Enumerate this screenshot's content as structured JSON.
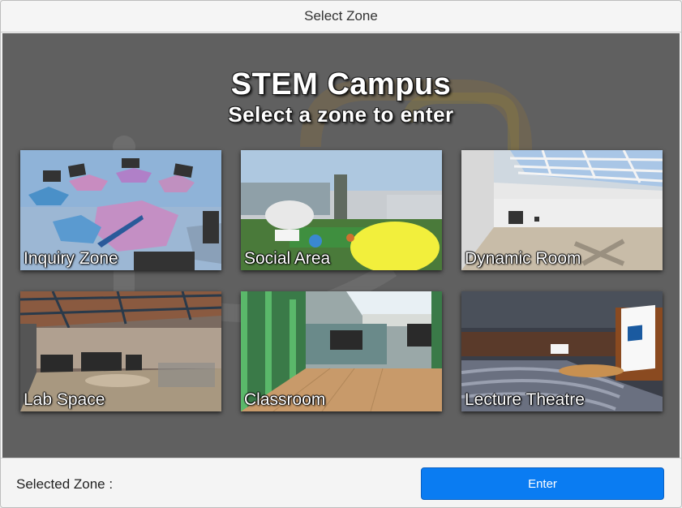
{
  "window": {
    "title": "Select Zone"
  },
  "header": {
    "title": "STEM Campus",
    "subtitle": "Select a zone to enter"
  },
  "zones": [
    {
      "label": "Inquiry Zone"
    },
    {
      "label": "Social Area"
    },
    {
      "label": "Dynamic Room"
    },
    {
      "label": "Lab Space"
    },
    {
      "label": "Classroom"
    },
    {
      "label": "Lecture Theatre"
    }
  ],
  "footer": {
    "selected_label": "Selected Zone :",
    "enter_label": "Enter"
  },
  "colors": {
    "accent": "#0a7cf2",
    "panel": "#606060"
  }
}
